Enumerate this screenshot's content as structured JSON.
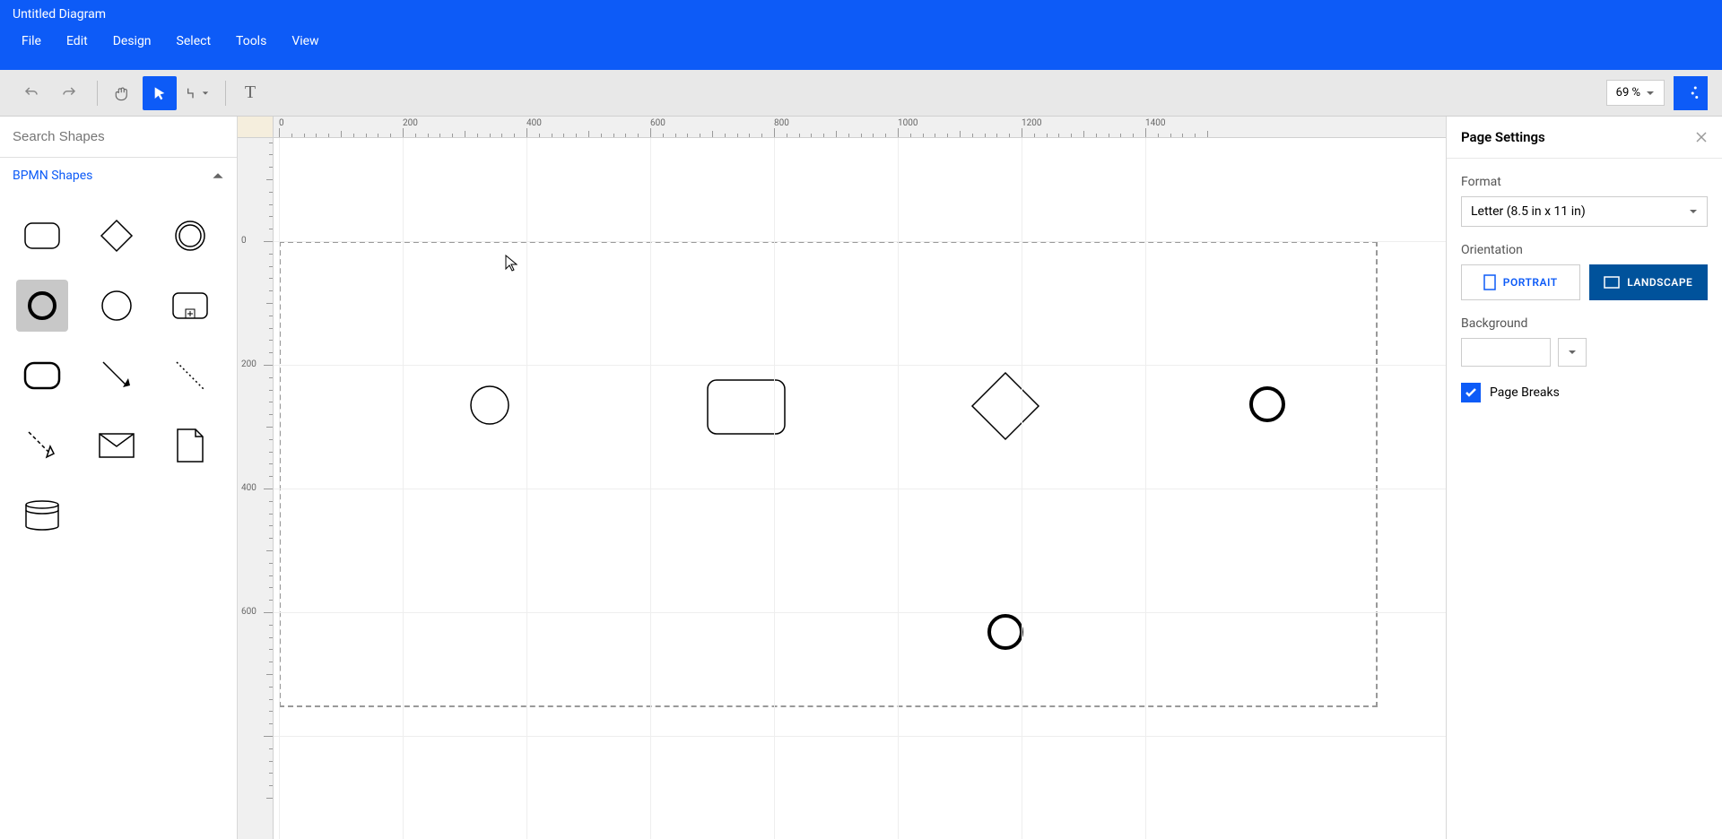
{
  "header": {
    "title": "Untitled Diagram",
    "menu": [
      "File",
      "Edit",
      "Design",
      "Select",
      "Tools",
      "View"
    ]
  },
  "toolbar": {
    "zoom": "69 %"
  },
  "sidebar_left": {
    "search_placeholder": "Search Shapes",
    "category": "BPMN Shapes"
  },
  "ruler_marks_h": [
    "0",
    "200",
    "400",
    "600",
    "800",
    "1000",
    "1200",
    "1400"
  ],
  "ruler_marks_v": [
    "0",
    "200",
    "400",
    "600"
  ],
  "panel": {
    "title": "Page Settings",
    "format_label": "Format",
    "format_value": "Letter (8.5 in x 11 in)",
    "orientation_label": "Orientation",
    "portrait": "PORTRAIT",
    "landscape": "LANDSCAPE",
    "background_label": "Background",
    "pagebreaks_label": "Page Breaks"
  }
}
